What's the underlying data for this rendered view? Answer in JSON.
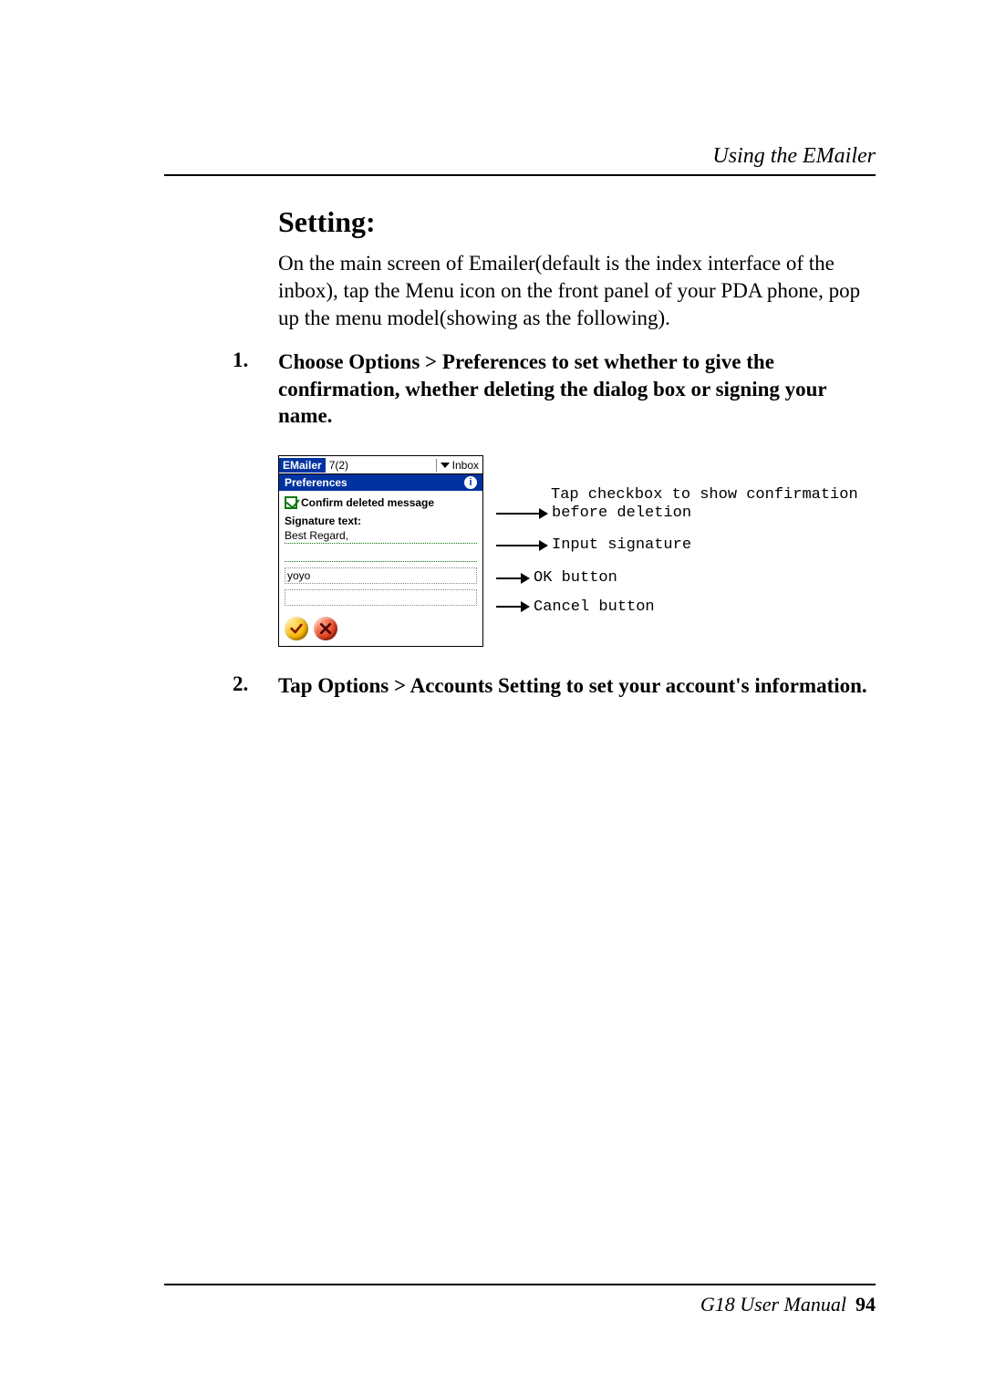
{
  "header": {
    "chapter_title": "Using the EMailer"
  },
  "section": {
    "title": "Setting:",
    "intro": "On the main screen of Emailer(default is the index interface of the inbox), tap the Menu icon on the front panel of your PDA phone, pop up the menu model(showing as the following)."
  },
  "steps": {
    "one_number": "1.",
    "one_text": "Choose Options > Preferences to set whether to give the confirmation, whether deleting the dialog box or signing your name.",
    "two_number": "2.",
    "two_text": "Tap Options > Accounts Setting to set your account's information."
  },
  "palm": {
    "app_name": "EMailer",
    "count": "7(2)",
    "dropdown": "Inbox",
    "pref_title": "Preferences",
    "confirm_label": "Confirm deleted message",
    "sig_label": "Signature text:",
    "sig_value": "Best Regard,",
    "sig_name": "yoyo"
  },
  "callouts": {
    "c1a": "Tap checkbox to show confirmation",
    "c1b": "before deletion",
    "c2": "Input signature",
    "c3": "OK button",
    "c4": "Cancel button"
  },
  "footer": {
    "manual": "G18 User Manual",
    "page": "94"
  }
}
